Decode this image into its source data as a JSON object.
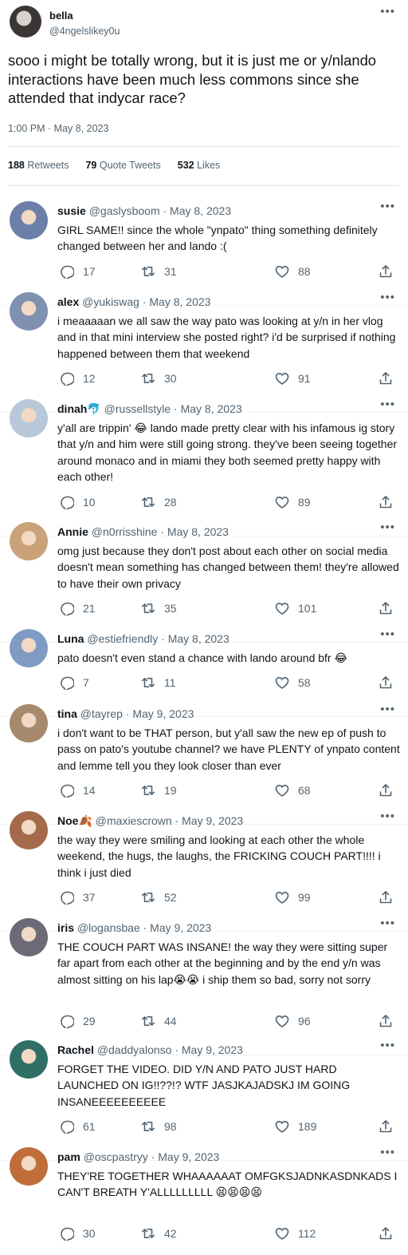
{
  "main_tweet": {
    "name": "bella",
    "handle": "@4ngelslikey0u",
    "text": "sooo i might be totally wrong, but it is just me or y/nlando interactions have been much less commons since she attended that indycar race?",
    "time": "1:00 PM · May 8, 2023",
    "retweets": "188",
    "retweets_label": "Retweets",
    "quotes": "79",
    "quotes_label": "Quote Tweets",
    "likes": "532",
    "likes_label": "Likes",
    "more_icon": "more-icon"
  },
  "replies": [
    {
      "name": "susie",
      "meta": "@gaslysboom · May 8, 2023",
      "text": "GIRL SAME!! since the whole \"ynpato\" thing something definitely changed between her and lando :(",
      "comments": "17",
      "retweets": "31",
      "likes": "88",
      "avatar_color": "#6b7fa8"
    },
    {
      "name": "alex",
      "meta": "@yukiswag · May 8, 2023",
      "text": "i meaaaaan we all saw the way pato was looking at y/n in her vlog and in that mini interview she posted right? i'd be surprised if nothing happened between them that weekend",
      "comments": "12",
      "retweets": "30",
      "likes": "91",
      "avatar_color": "#8090b0"
    },
    {
      "name": "dinah",
      "name_emoji": "🐬",
      "meta": "@russellstyle · May 8, 2023",
      "text": "y'all are trippin' 😂 lando made pretty clear with his infamous ig story that y/n and him were still going strong. they've been seeing together around monaco and in miami they both seemed pretty happy with each other!",
      "comments": "10",
      "retweets": "28",
      "likes": "89",
      "avatar_color": "#b9c8d8"
    },
    {
      "name": "Annie",
      "meta": "@n0rrisshine · May 8, 2023",
      "text": "omg just because they don't post about each other on social media doesn't mean something has changed between them! they're allowed to have their own privacy",
      "comments": "21",
      "retweets": "35",
      "likes": "101",
      "avatar_color": "#c9a27a"
    },
    {
      "name": "Luna",
      "meta": "@estiefriendly · May 8, 2023",
      "text": "pato doesn't even stand a chance with lando around bfr 😂",
      "comments": "7",
      "retweets": "11",
      "likes": "58",
      "avatar_color": "#7f9bc4"
    },
    {
      "name": "tina",
      "meta": "@tayrep · May 9, 2023",
      "text": "i don't want to be THAT person, but y'all saw the new ep of push to pass on pato's youtube channel? we have PLENTY of ynpato content and lemme tell you they look closer than ever",
      "comments": "14",
      "retweets": "19",
      "likes": "68",
      "avatar_color": "#a78a6e"
    },
    {
      "name": "Noe",
      "name_emoji": "🍂",
      "meta": "@maxiescrown · May 9, 2023",
      "text": "the way they were smiling and looking at each other the whole weekend, the hugs, the laughs, the FRICKING COUCH PART!!!! i think i just died",
      "comments": "37",
      "retweets": "52",
      "likes": "99",
      "avatar_color": "#a56a4c"
    },
    {
      "name": "iris",
      "meta": "@logansbae · May 9, 2023",
      "text": "THE COUCH PART WAS INSANE! the way they were sitting super far apart from each other at the beginning and by the end y/n was almost sitting on his lap😭😭 i ship them so bad, sorry not sorry",
      "comments": "29",
      "retweets": "44",
      "likes": "96",
      "avatar_color": "#6d6a78"
    },
    {
      "name": "Rachel",
      "meta": "@daddyalonso · May 9, 2023",
      "text": "FORGET THE VIDEO. DID Y/N AND PATO JUST HARD LAUNCHED ON IG!!??!? WTF JASJKAJADSKJ IM GOING INSANEEEEEEEEEE",
      "comments": "61",
      "retweets": "98",
      "likes": "189",
      "avatar_color": "#2f6f66"
    },
    {
      "name": "pam",
      "meta": "@oscpastryy · May 9, 2023",
      "text": "THEY'RE TOGETHER WHAAAAAAT OMFGKSJADNKASDNKADS I CAN'T BREATH Y'ALLLLLLLLL 😫😫😫😫",
      "comments": "30",
      "retweets": "42",
      "likes": "112",
      "avatar_color": "#c06d3a"
    }
  ],
  "icons": {
    "comment": "comment-icon",
    "retweet": "retweet-icon",
    "like": "heart-icon",
    "share": "share-icon",
    "more": "more-icon"
  }
}
